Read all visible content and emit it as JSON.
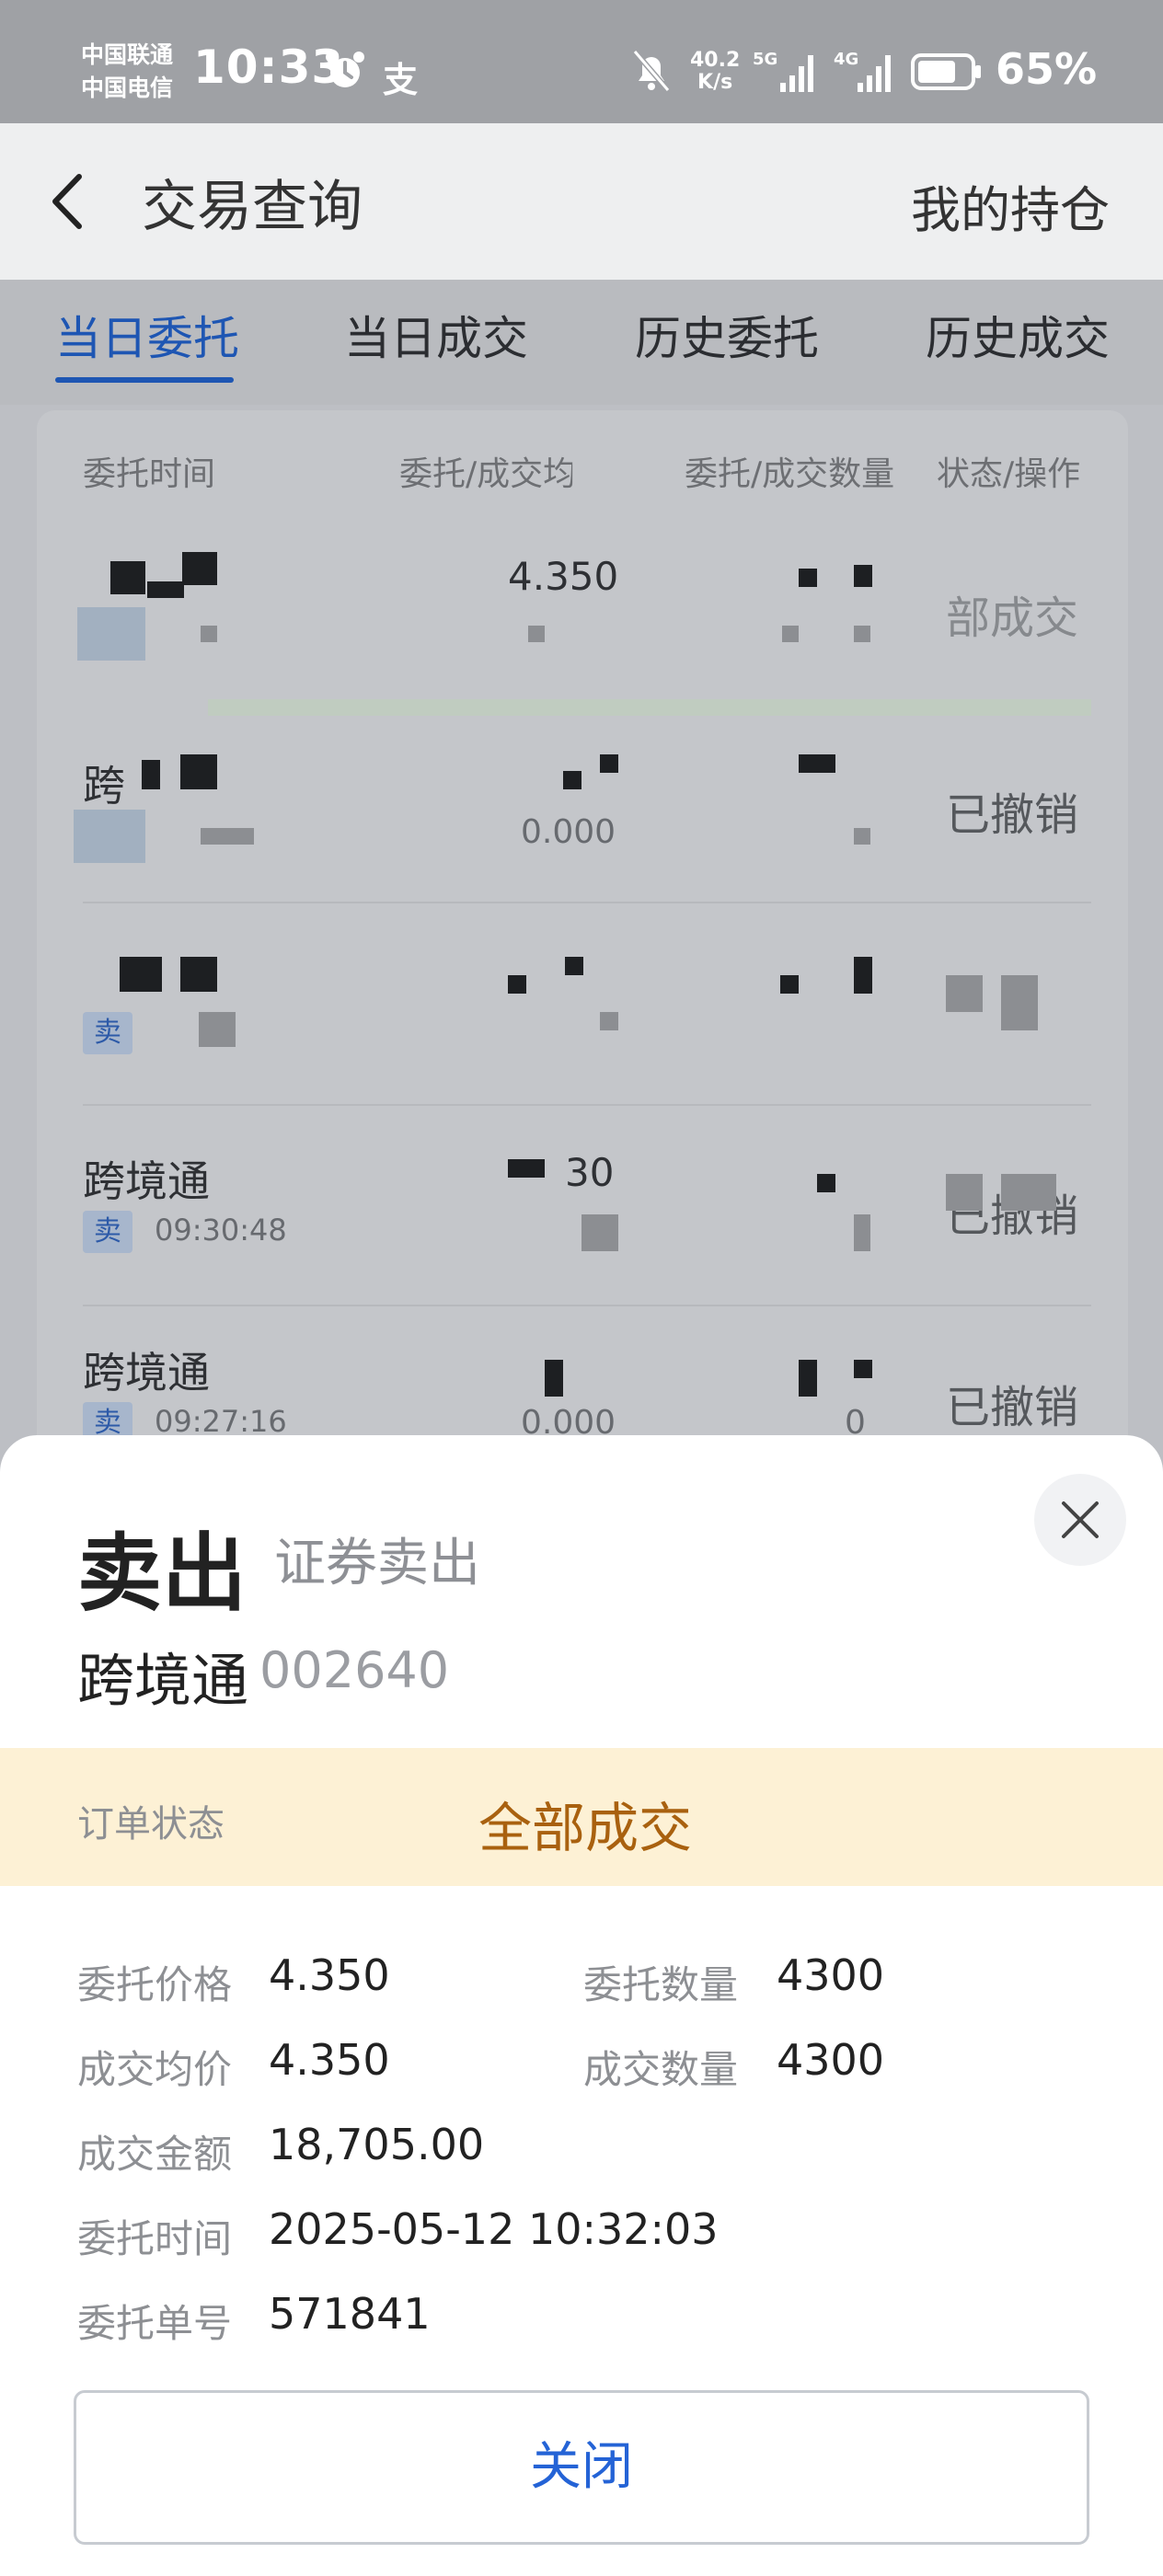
{
  "status_bar": {
    "carrier_1": "中国联通",
    "carrier_2": "中国电信",
    "time": "10:33",
    "pay_icon_text": "支",
    "net_speed_value": "40.2",
    "net_speed_unit": "K/s",
    "signal_1": "5G",
    "signal_2": "4G",
    "battery": "65%"
  },
  "nav": {
    "title": "交易查询",
    "right_link": "我的持仓"
  },
  "tabs": [
    {
      "label": "当日委托",
      "active": true
    },
    {
      "label": "当日成交",
      "active": false
    },
    {
      "label": "历史委托",
      "active": false
    },
    {
      "label": "历史成交",
      "active": false
    }
  ],
  "list_headers": [
    "委托时间",
    "委托/成交均价",
    "委托/成交数量",
    "状态/操作"
  ],
  "rows": [
    {
      "name": "",
      "price": "4.350",
      "status": "部成交"
    },
    {
      "name": "跨",
      "price2": "0.000",
      "status": "已撤销"
    },
    {
      "name": "",
      "badge": "卖",
      "status": ""
    },
    {
      "name": "跨境通",
      "badge": "卖",
      "time": "09:30:48",
      "price": "30",
      "status": "已撤销"
    },
    {
      "name": "跨境通",
      "badge": "卖",
      "time": "09:27:16",
      "price2": "0.000",
      "qty2": "0",
      "status": "已撤销"
    }
  ],
  "sheet": {
    "title": "卖出",
    "subtitle": "证券卖出",
    "stock_name": "跨境通",
    "stock_code": "002640",
    "status_label": "订单状态",
    "status_value": "全部成交",
    "details": {
      "order_price_label": "委托价格",
      "order_price": "4.350",
      "order_qty_label": "委托数量",
      "order_qty": "4300",
      "avg_price_label": "成交均价",
      "avg_price": "4.350",
      "deal_qty_label": "成交数量",
      "deal_qty": "4300",
      "amount_label": "成交金额",
      "amount": "18,705.00",
      "order_time_label": "委托时间",
      "order_time": "2025-05-12 10:32:03",
      "order_no_label": "委托单号",
      "order_no": "571841"
    },
    "close_button": "关闭"
  }
}
